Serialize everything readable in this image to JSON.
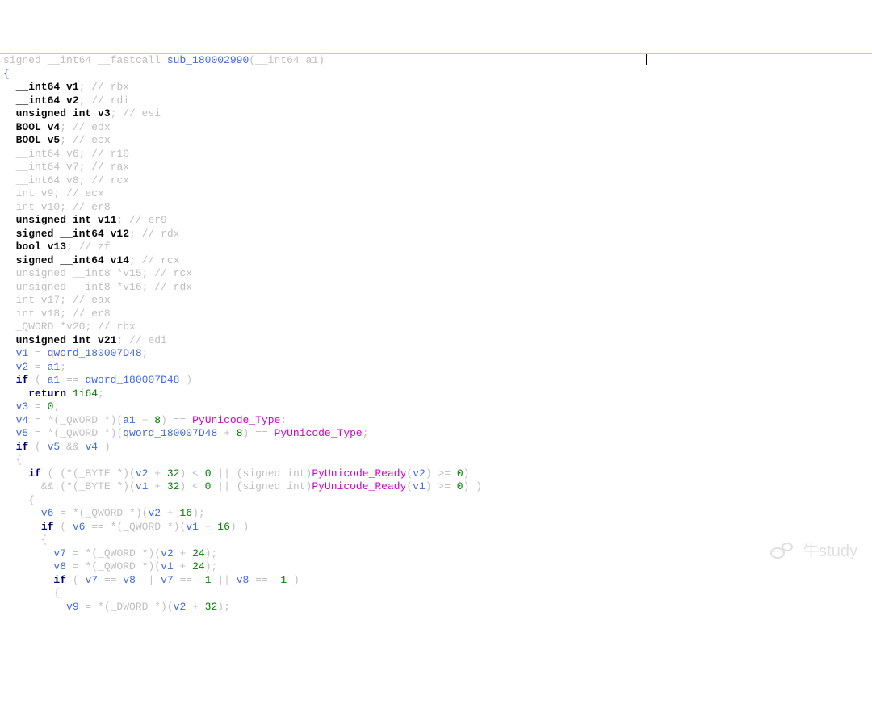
{
  "watermark": "牛study",
  "lines": [
    [
      [
        "signed __int64 __fastcall",
        "tok-c"
      ],
      [
        " ",
        ""
      ],
      [
        "sub_180002990",
        "tok-v"
      ],
      [
        "(",
        ""
      ],
      [
        "__int64",
        "tok-c"
      ],
      [
        " ",
        ""
      ],
      [
        "a1",
        "tok-c"
      ],
      [
        ")                                                   ",
        ""
      ],
      [
        "",
        "caret-here"
      ]
    ],
    [
      [
        "{",
        "tok-v"
      ]
    ],
    [
      [
        "  __int64 v1",
        "tok-kg"
      ],
      [
        "; ",
        ""
      ],
      [
        "// rbx",
        "tok-c"
      ]
    ],
    [
      [
        "  __int64 v2",
        "tok-kg"
      ],
      [
        "; ",
        ""
      ],
      [
        "// rdi",
        "tok-c"
      ]
    ],
    [
      [
        "  unsigned int v3",
        "tok-kg"
      ],
      [
        "; ",
        ""
      ],
      [
        "// esi",
        "tok-c"
      ]
    ],
    [
      [
        "  BOOL v4",
        "tok-kg"
      ],
      [
        "; ",
        ""
      ],
      [
        "// edx",
        "tok-c"
      ]
    ],
    [
      [
        "  BOOL v5",
        "tok-kg"
      ],
      [
        "; ",
        ""
      ],
      [
        "// ecx",
        "tok-c"
      ]
    ],
    [
      [
        "  __int64 v6",
        "tok-c"
      ],
      [
        "; ",
        ""
      ],
      [
        "// r10",
        "tok-c"
      ]
    ],
    [
      [
        "  __int64 v7",
        "tok-c"
      ],
      [
        "; ",
        ""
      ],
      [
        "// rax",
        "tok-c"
      ]
    ],
    [
      [
        "  __int64 v8",
        "tok-c"
      ],
      [
        "; ",
        ""
      ],
      [
        "// rcx",
        "tok-c"
      ]
    ],
    [
      [
        "  int v9",
        "tok-c"
      ],
      [
        "; ",
        ""
      ],
      [
        "// ecx",
        "tok-c"
      ]
    ],
    [
      [
        "  int v10",
        "tok-c"
      ],
      [
        "; ",
        ""
      ],
      [
        "// er8",
        "tok-c"
      ]
    ],
    [
      [
        "  unsigned int v11",
        "tok-kg"
      ],
      [
        "; ",
        ""
      ],
      [
        "// er9",
        "tok-c"
      ]
    ],
    [
      [
        "  signed __int64 v12",
        "tok-kg"
      ],
      [
        "; ",
        ""
      ],
      [
        "// rdx",
        "tok-c"
      ]
    ],
    [
      [
        "  bool v13",
        "tok-kg"
      ],
      [
        "; ",
        ""
      ],
      [
        "// zf",
        "tok-c"
      ]
    ],
    [
      [
        "  signed __int64 v14",
        "tok-kg"
      ],
      [
        "; ",
        ""
      ],
      [
        "// rcx",
        "tok-c"
      ]
    ],
    [
      [
        "  unsigned __int8 *v15",
        "tok-c"
      ],
      [
        "; ",
        ""
      ],
      [
        "// rcx",
        "tok-c"
      ]
    ],
    [
      [
        "  unsigned __int8 *v16",
        "tok-c"
      ],
      [
        "; ",
        ""
      ],
      [
        "// rdx",
        "tok-c"
      ]
    ],
    [
      [
        "  int v17",
        "tok-c"
      ],
      [
        "; ",
        ""
      ],
      [
        "// eax",
        "tok-c"
      ]
    ],
    [
      [
        "  int v18",
        "tok-c"
      ],
      [
        "; ",
        ""
      ],
      [
        "// er8",
        "tok-c"
      ]
    ],
    [
      [
        "  _QWORD *v20",
        "tok-c"
      ],
      [
        "; ",
        ""
      ],
      [
        "// rbx",
        "tok-c"
      ]
    ],
    [
      [
        "  unsigned int v21",
        "tok-kg"
      ],
      [
        "; ",
        ""
      ],
      [
        "// edi",
        "tok-c"
      ]
    ],
    [
      [
        "",
        ""
      ]
    ],
    [
      [
        "  ",
        ""
      ],
      [
        "v1",
        "tok-v"
      ],
      [
        " = ",
        ""
      ],
      [
        "qword_180007D48",
        "tok-v"
      ],
      [
        ";",
        ""
      ]
    ],
    [
      [
        "  ",
        ""
      ],
      [
        "v2",
        "tok-v"
      ],
      [
        " = ",
        ""
      ],
      [
        "a1",
        "tok-v"
      ],
      [
        ";",
        ""
      ]
    ],
    [
      [
        "  ",
        ""
      ],
      [
        "if",
        "tok-k"
      ],
      [
        " ( ",
        ""
      ],
      [
        "a1",
        "tok-v"
      ],
      [
        " == ",
        ""
      ],
      [
        "qword_180007D48",
        "tok-v"
      ],
      [
        " )",
        ""
      ]
    ],
    [
      [
        "    ",
        ""
      ],
      [
        "return",
        "tok-k"
      ],
      [
        " ",
        ""
      ],
      [
        "1i64",
        "tok-n"
      ],
      [
        ";",
        ""
      ]
    ],
    [
      [
        "  ",
        ""
      ],
      [
        "v3",
        "tok-v"
      ],
      [
        " = ",
        ""
      ],
      [
        "0",
        "tok-n"
      ],
      [
        ";",
        ""
      ]
    ],
    [
      [
        "  ",
        ""
      ],
      [
        "v4",
        "tok-v"
      ],
      [
        " = *(_QWORD *)(",
        ""
      ],
      [
        "a1",
        "tok-v"
      ],
      [
        " + ",
        ""
      ],
      [
        "8",
        "tok-n"
      ],
      [
        ") == ",
        ""
      ],
      [
        "PyUnicode_Type",
        "tok-f"
      ],
      [
        ";",
        ""
      ]
    ],
    [
      [
        "  ",
        ""
      ],
      [
        "v5",
        "tok-v"
      ],
      [
        " = *(_QWORD *)(",
        ""
      ],
      [
        "qword_180007D48",
        "tok-v"
      ],
      [
        " + ",
        ""
      ],
      [
        "8",
        "tok-n"
      ],
      [
        ") == ",
        ""
      ],
      [
        "PyUnicode_Type",
        "tok-f"
      ],
      [
        ";",
        ""
      ]
    ],
    [
      [
        "  ",
        ""
      ],
      [
        "if",
        "tok-k"
      ],
      [
        " ( ",
        ""
      ],
      [
        "v5",
        "tok-v"
      ],
      [
        " && ",
        ""
      ],
      [
        "v4",
        "tok-v"
      ],
      [
        " )",
        ""
      ]
    ],
    [
      [
        "  {",
        ""
      ]
    ],
    [
      [
        "    ",
        ""
      ],
      [
        "if",
        "tok-k"
      ],
      [
        " ( (*(_BYTE *)(",
        ""
      ],
      [
        "v2",
        "tok-v"
      ],
      [
        " + ",
        ""
      ],
      [
        "32",
        "tok-n"
      ],
      [
        ") < ",
        ""
      ],
      [
        "0",
        "tok-n"
      ],
      [
        " || (",
        ""
      ],
      [
        "signed int",
        "tok-c"
      ],
      [
        ")",
        ""
      ],
      [
        "PyUnicode_Ready",
        "tok-f"
      ],
      [
        "(",
        ""
      ],
      [
        "v2",
        "tok-v"
      ],
      [
        ") >= ",
        ""
      ],
      [
        "0",
        "tok-n"
      ],
      [
        ")",
        ""
      ]
    ],
    [
      [
        "      && (*(_BYTE *)(",
        ""
      ],
      [
        "v1",
        "tok-v"
      ],
      [
        " + ",
        ""
      ],
      [
        "32",
        "tok-n"
      ],
      [
        ") < ",
        ""
      ],
      [
        "0",
        "tok-n"
      ],
      [
        " || (",
        ""
      ],
      [
        "signed int",
        "tok-c"
      ],
      [
        ")",
        ""
      ],
      [
        "PyUnicode_Ready",
        "tok-f"
      ],
      [
        "(",
        ""
      ],
      [
        "v1",
        "tok-v"
      ],
      [
        ") >= ",
        ""
      ],
      [
        "0",
        "tok-n"
      ],
      [
        ") )",
        ""
      ]
    ],
    [
      [
        "    {",
        ""
      ]
    ],
    [
      [
        "      ",
        ""
      ],
      [
        "v6",
        "tok-v"
      ],
      [
        " = *(_QWORD *)(",
        ""
      ],
      [
        "v2",
        "tok-v"
      ],
      [
        " + ",
        ""
      ],
      [
        "16",
        "tok-n"
      ],
      [
        ");",
        ""
      ]
    ],
    [
      [
        "      ",
        ""
      ],
      [
        "if",
        "tok-k"
      ],
      [
        " ( ",
        ""
      ],
      [
        "v6",
        "tok-v"
      ],
      [
        " == *(_QWORD *)(",
        ""
      ],
      [
        "v1",
        "tok-v"
      ],
      [
        " + ",
        ""
      ],
      [
        "16",
        "tok-n"
      ],
      [
        ") )",
        ""
      ]
    ],
    [
      [
        "      {",
        ""
      ]
    ],
    [
      [
        "        ",
        ""
      ],
      [
        "v7",
        "tok-v"
      ],
      [
        " = *(_QWORD *)(",
        ""
      ],
      [
        "v2",
        "tok-v"
      ],
      [
        " + ",
        ""
      ],
      [
        "24",
        "tok-n"
      ],
      [
        ");",
        ""
      ]
    ],
    [
      [
        "        ",
        ""
      ],
      [
        "v8",
        "tok-v"
      ],
      [
        " = *(_QWORD *)(",
        ""
      ],
      [
        "v1",
        "tok-v"
      ],
      [
        " + ",
        ""
      ],
      [
        "24",
        "tok-n"
      ],
      [
        ");",
        ""
      ]
    ],
    [
      [
        "        ",
        ""
      ],
      [
        "if",
        "tok-k"
      ],
      [
        " ( ",
        ""
      ],
      [
        "v7",
        "tok-v"
      ],
      [
        " == ",
        ""
      ],
      [
        "v8",
        "tok-v"
      ],
      [
        " || ",
        ""
      ],
      [
        "v7",
        "tok-v"
      ],
      [
        " == ",
        ""
      ],
      [
        "-1",
        "tok-n"
      ],
      [
        " || ",
        ""
      ],
      [
        "v8",
        "tok-v"
      ],
      [
        " == ",
        ""
      ],
      [
        "-1",
        "tok-n"
      ],
      [
        " )",
        ""
      ]
    ],
    [
      [
        "        {",
        ""
      ]
    ],
    [
      [
        "          ",
        ""
      ],
      [
        "v9",
        "tok-v"
      ],
      [
        " = *(_DWORD *)(",
        ""
      ],
      [
        "v2",
        "tok-v"
      ],
      [
        " + ",
        ""
      ],
      [
        "32",
        "tok-n"
      ],
      [
        ");",
        ""
      ]
    ]
  ]
}
